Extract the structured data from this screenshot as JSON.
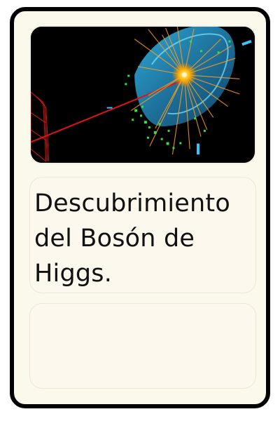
{
  "card": {
    "image": {
      "icon": "particle-collision-event-icon",
      "accent": "#33c7ff"
    },
    "title": "Descubrimiento del Bosón de Higgs.",
    "detail_text": ""
  },
  "colors": {
    "card_background": "#fbf8ec",
    "border": "#000000",
    "panel_border": "#ebe6d6"
  }
}
